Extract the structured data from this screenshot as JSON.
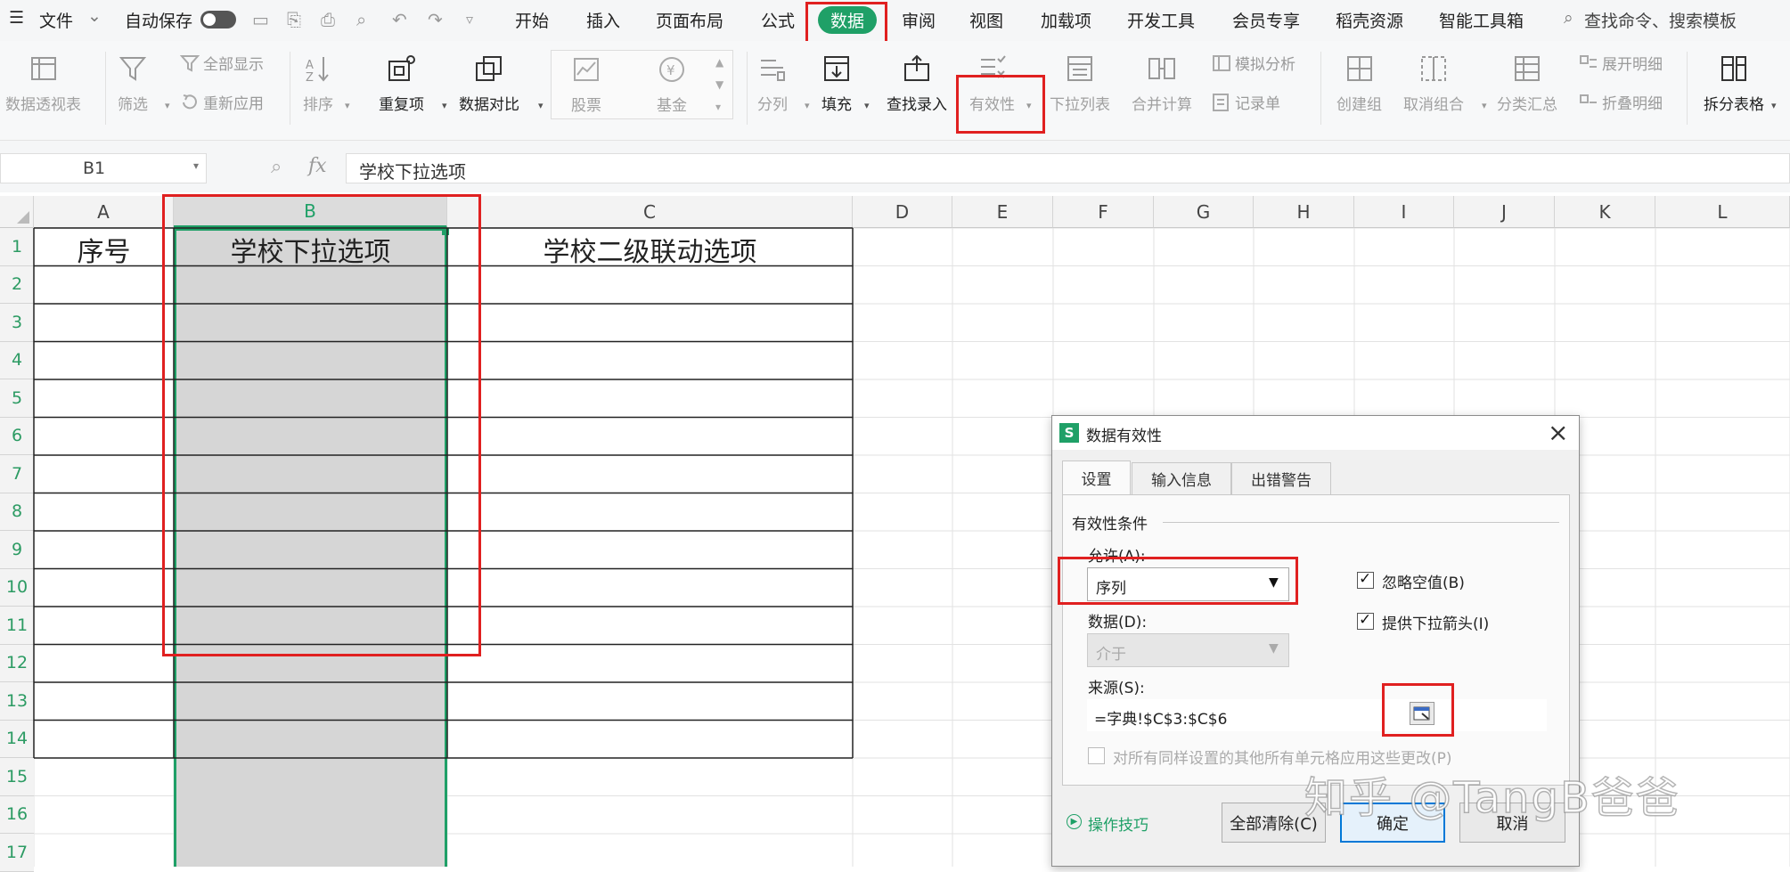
{
  "menu": {
    "file_label": "文件",
    "autosave_label": "自动保存",
    "tabs": [
      {
        "label": "开始"
      },
      {
        "label": "插入"
      },
      {
        "label": "页面布局"
      },
      {
        "label": "公式"
      },
      {
        "label": "数据"
      },
      {
        "label": "审阅"
      },
      {
        "label": "视图"
      },
      {
        "label": "加载项"
      },
      {
        "label": "开发工具"
      },
      {
        "label": "会员专享"
      },
      {
        "label": "稻壳资源"
      },
      {
        "label": "智能工具箱"
      }
    ],
    "search_label": "查找命令、搜索模板"
  },
  "ribbon": {
    "pivot": "数据透视表",
    "filter": "筛选",
    "show_all": "全部显示",
    "reapply": "重新应用",
    "sort": "排序",
    "duplicates": "重复项",
    "compare": "数据对比",
    "stocks": "股票",
    "funds": "基金",
    "split": "分列",
    "fill": "填充",
    "lookup": "查找录入",
    "validity": "有效性",
    "dropdown": "下拉列表",
    "consolidate": "合并计算",
    "simulate": "模拟分析",
    "record": "记录单",
    "group": "创建组",
    "ungroup": "取消组合",
    "subtotal": "分类汇总",
    "expand": "展开明细",
    "collapse": "折叠明细",
    "split_table": "拆分表格"
  },
  "formula_bar": {
    "cell_ref": "B1",
    "fx": "fx",
    "content": "学校下拉选项"
  },
  "sheet": {
    "columns": [
      "A",
      "B",
      "C",
      "D",
      "E",
      "F",
      "G",
      "H",
      "I",
      "J",
      "K",
      "L"
    ],
    "rows": [
      "1",
      "2",
      "3",
      "4",
      "5",
      "6",
      "7",
      "8",
      "9",
      "10",
      "11",
      "12",
      "13",
      "14",
      "15",
      "16",
      "17"
    ],
    "headers": {
      "a1": "序号",
      "b1": "学校下拉选项",
      "c1": "学校二级联动选项"
    }
  },
  "dialog": {
    "title": "数据有效性",
    "tabs": [
      {
        "label": "设置"
      },
      {
        "label": "输入信息"
      },
      {
        "label": "出错警告"
      }
    ],
    "group_label": "有效性条件",
    "allow_label": "允许(A):",
    "allow_value": "序列",
    "data_label": "数据(D):",
    "data_value": "介于",
    "ignore_blank": "忽略空值(B)",
    "dropdown_arrow": "提供下拉箭头(I)",
    "source_label": "来源(S):",
    "source_value": "=字典!$C$3:$C$6",
    "apply_all": "对所有同样设置的其他所有单元格应用这些更改(P)",
    "tips": "操作技巧",
    "clear_all": "全部清除(C)",
    "ok": "确定",
    "cancel": "取消"
  },
  "watermark": "知乎 @TangB爸爸",
  "colors": {
    "accent": "#1fa067",
    "highlight_red": "#e02020",
    "selection_gray": "#d6d6d6"
  }
}
